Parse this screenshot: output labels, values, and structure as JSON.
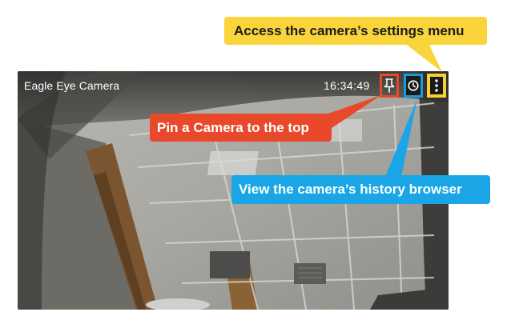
{
  "camera": {
    "title": "Eagle Eye Camera",
    "timestamp": "16:34:49",
    "buttons": {
      "pin_icon": "pin-icon",
      "history_icon": "clock-icon",
      "menu_icon": "vertical-ellipsis-icon"
    }
  },
  "callouts": {
    "settings": "Access the camera’s settings menu",
    "pin": "Pin a Camera to the top",
    "history": "View the camera’s history browser"
  },
  "colors": {
    "settings_accent": "#f9d43a",
    "pin_accent": "#e8492b",
    "history_accent": "#1aa6e6"
  }
}
